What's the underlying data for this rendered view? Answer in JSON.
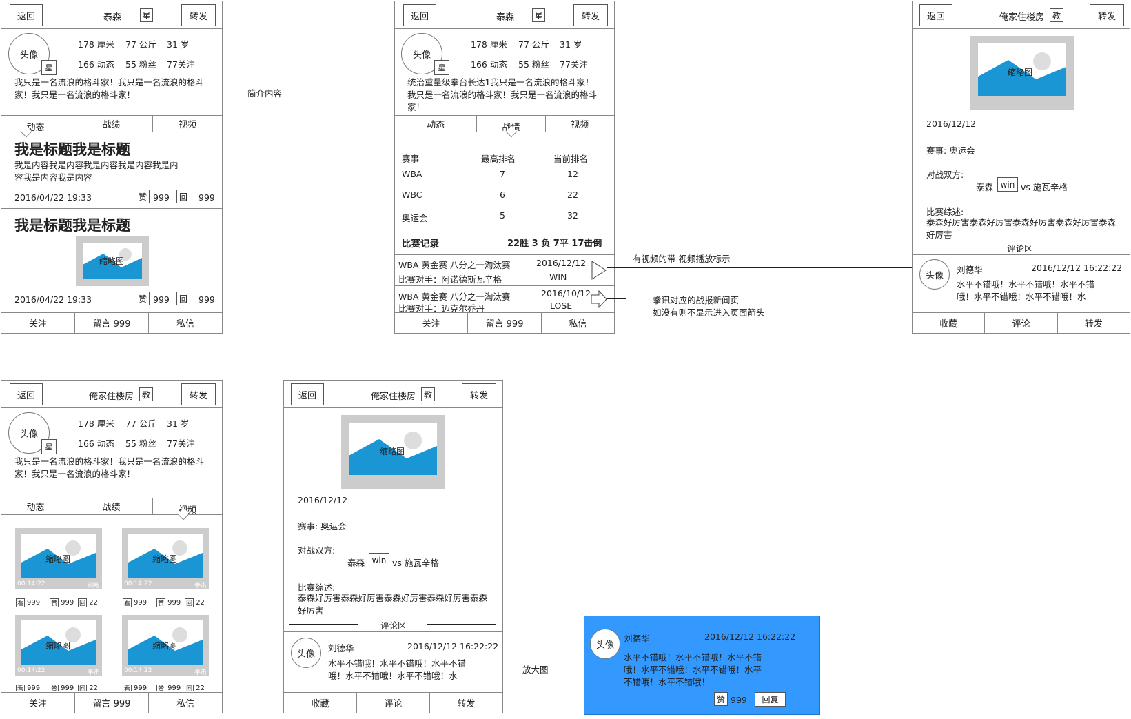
{
  "common": {
    "back": "返回",
    "forward": "转发",
    "avatar": "头像",
    "star": "星",
    "teach": "教",
    "height": "178 厘米",
    "weight": "77 公斤",
    "age": "31 岁",
    "posts": "166 动态",
    "fans": "55 粉丝",
    "follows": "77关注",
    "tab_dynamic": "动态",
    "tab_record": "战绩",
    "tab_video": "视频",
    "follow": "关注",
    "message": "留言 999",
    "private_msg": "私信",
    "collect": "收藏",
    "comment": "评论",
    "thumb": "缩略图",
    "like": "赞",
    "reply": "回",
    "view": "看",
    "n999": "999",
    "n22": "22"
  },
  "screen1": {
    "name": "泰森",
    "bio": "我只是一名流浪的格斗家！我只是一名流浪的格斗家！我只是一名流浪的格斗家！",
    "post_title": "我是标题我是标题",
    "post_content": "我是内容我是内容我是内容我是内容我是内容我是内容我是内容",
    "post_time": "2016/04/22 19:33"
  },
  "screen2": {
    "name": "泰森",
    "bio": "统治重量级拳台长达1我只是一名流浪的格斗家！我只是一名流浪的格斗家！我只是一名流浪的格斗家！",
    "headers": [
      "赛事",
      "最高排名",
      "当前排名"
    ],
    "rows": [
      [
        "WBA",
        "7",
        "12"
      ],
      [
        "WBC",
        "6",
        "22"
      ],
      [
        "奥运会",
        "5",
        "32"
      ]
    ],
    "record_label": "比赛记录",
    "record_value": "22胜 3 负 7平 17击倒",
    "matches": [
      {
        "title": "WBA 黄金赛 八分之一淘汰赛",
        "date": "2016/12/12",
        "opponent": "比赛对手：阿诺德斯瓦辛格",
        "result": "WIN"
      },
      {
        "title": "WBA 黄金赛 八分之一淘汰赛",
        "date": "2016/10/12",
        "opponent": "比赛对手：迈克尔乔丹",
        "result": "LOSE"
      }
    ]
  },
  "detail": {
    "name": "俺家住楼房",
    "date": "2016/12/12",
    "event": "赛事: 奥运会",
    "versus_label": "对战双方:",
    "player1": "泰森",
    "win": "win",
    "versus": "vs 施瓦辛格",
    "summary_label": "比赛综述:",
    "summary": "泰森好厉害泰森好厉害泰森好厉害泰森好厉害泰森好厉害",
    "comment_area": "评论区",
    "commenter": "刘德华",
    "comment_time": "2016/12/12 16:22:22",
    "comment_text": "水平不错哦！水平不错哦！水平不错哦！水平不错哦！水平不错哦！水",
    "comment_full": "水平不错哦！水平不错哦！水平不错哦！水平不错哦！水平不错哦！水平不错哦！水平不错哦！",
    "reply_btn": "回复"
  },
  "screen4": {
    "name": "俺家住楼房",
    "bio": "我只是一名流浪的格斗家！我只是一名流浪的格斗家！我只是一名流浪的格斗家！",
    "video_time": "00:14:22",
    "tag_train": "训练",
    "tag_boxing": "拳击"
  },
  "annotations": {
    "bio": "简介内容",
    "video_mark": "有视频的带 视频播放标示",
    "news_line1": "拳讯对应的战报新闻页",
    "news_line2": "如没有则不显示进入页面箭头",
    "enlarge": "放大图"
  },
  "colors": {
    "accent": "#3399ff",
    "mountain": "#1a96d4",
    "thumb_bg": "#cccccc",
    "sun": "#dddddd"
  }
}
